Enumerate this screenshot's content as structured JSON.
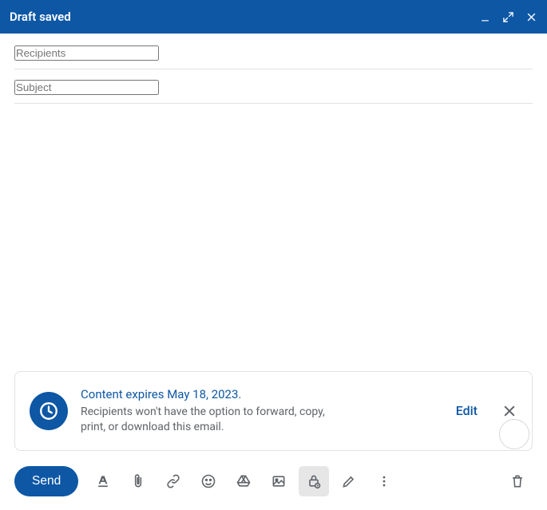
{
  "header": {
    "title": "Draft saved"
  },
  "recipients": {
    "placeholder": "Recipients",
    "value": ""
  },
  "subject": {
    "placeholder": "Subject",
    "value": ""
  },
  "confidential_banner": {
    "expires_text": "Content expires May 18, 2023.",
    "note_text": "Recipients won't have the option to forward, copy, print, or download this email.",
    "edit_label": "Edit"
  },
  "footer": {
    "send_label": "Send"
  }
}
